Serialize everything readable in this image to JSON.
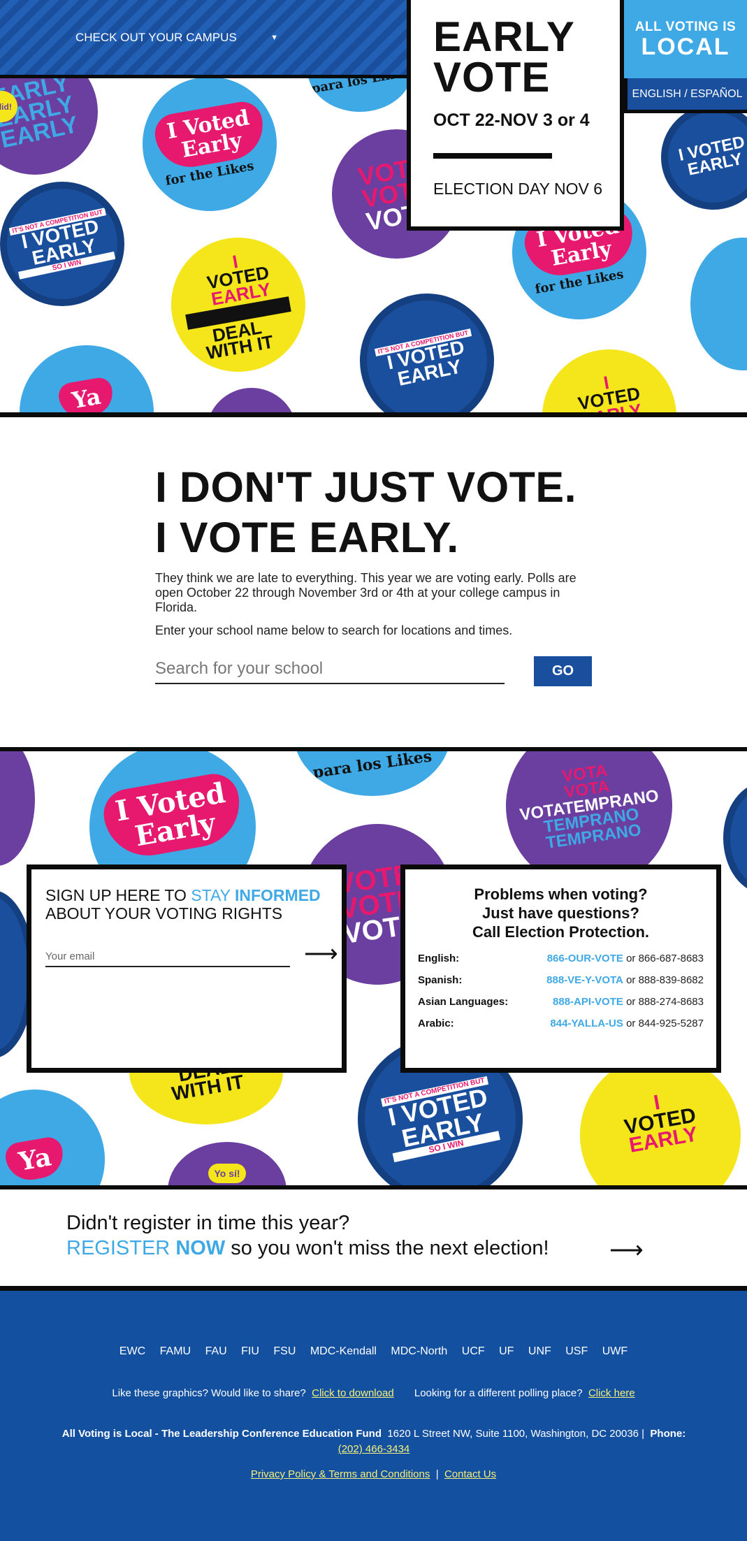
{
  "topbar": {
    "campus_select": "CHECK OUT YOUR CAMPUS"
  },
  "early_box": {
    "title": "EARLY\nVOTE",
    "dates": "OCT 22-NOV 3 or 4",
    "election_day": "ELECTION DAY NOV 6"
  },
  "logo": {
    "top": "ALL VOTING IS",
    "bottom": "LOCAL"
  },
  "language_toggle": "ENGLISH / ESPAÑOL",
  "stickers": {
    "voted_early_likes": [
      "I Voted",
      "Early",
      "for the Likes"
    ],
    "not_competition": [
      "IT'S NOT A COMPETITION BUT",
      "I VOTED",
      "EARLY",
      "SO I WIN"
    ],
    "deal_with_it": [
      "I",
      "VOTED",
      "EARLY",
      "DEAL",
      "WITH IT"
    ],
    "early_stack": [
      "EARLY",
      "EARLY",
      "EARLY"
    ],
    "vote_stack": [
      "VOTE",
      "VOTE",
      "VOTE"
    ],
    "i_did": "I did!",
    "ya_vote": "Ya",
    "para_los_likes": "para los Likes",
    "votatemprano": [
      "VOTA",
      "VOTA",
      "VOTATEMPRANO",
      "TEMPRANO",
      "TEMPRANO"
    ],
    "yo_si": "Yo sí!"
  },
  "intro": {
    "heading": "I DON'T JUST VOTE.\nI VOTE EARLY.",
    "body": "They think we are late to everything. This year we are voting early. Polls are open October 22 through November 3rd or 4th at your college campus in Florida.",
    "body2": "Enter your school name below to search for locations and times.",
    "search_placeholder": "Search for your school",
    "go_label": "GO"
  },
  "signup": {
    "title_pre": "SIGN UP HERE TO ",
    "title_hl": "STAY ",
    "title_hl_bold": "INFORMED",
    "title_post": "ABOUT YOUR VOTING RIGHTS",
    "email_placeholder": "Your email"
  },
  "help": {
    "title": "Problems when voting?\nJust have questions?\nCall Election Protection.",
    "rows": [
      {
        "lang": "English:",
        "link": "866-OUR-VOTE",
        "or": " or 866-687-8683"
      },
      {
        "lang": "Spanish:",
        "link": "888-VE-Y-VOTA",
        "or": " or 888-839-8682"
      },
      {
        "lang": "Asian Languages:",
        "link": "888-API-VOTE",
        "or": " or 888-274-8683"
      },
      {
        "lang": "Arabic:",
        "link": "844-YALLA-US",
        "or": " or 844-925-5287"
      }
    ]
  },
  "register": {
    "line1": "Didn't register in time this year?",
    "link_a": "REGISTER ",
    "link_b": "NOW",
    "line2_post": " so you won't miss the next election!"
  },
  "footer": {
    "campuses": [
      "EWC",
      "FAMU",
      "FAU",
      "FIU",
      "FSU",
      "MDC-Kendall",
      "MDC-North",
      "UCF",
      "UF",
      "UNF",
      "USF",
      "UWF"
    ],
    "share_q": "Like these graphics? Would like to share?",
    "share_link": "Click to download",
    "polling_q": "Looking for a different polling place?",
    "polling_link": "Click here",
    "org": "All Voting is Local - The Leadership Conference Education Fund",
    "address": "1620 L Street NW, Suite 1100, Washington, DC 20036 |",
    "phone_label": "Phone:",
    "phone": "(202) 466-3434",
    "privacy": "Privacy Policy & Terms and Conditions",
    "separator": "|",
    "contact": "Contact Us"
  },
  "colors": {
    "brand_blue": "#1a4f9e",
    "light_blue": "#3fa9e6",
    "pink": "#e6196f",
    "yellow": "#f4e61b",
    "purple": "#6a3fa0",
    "link_yellow": "#f6f07a"
  }
}
